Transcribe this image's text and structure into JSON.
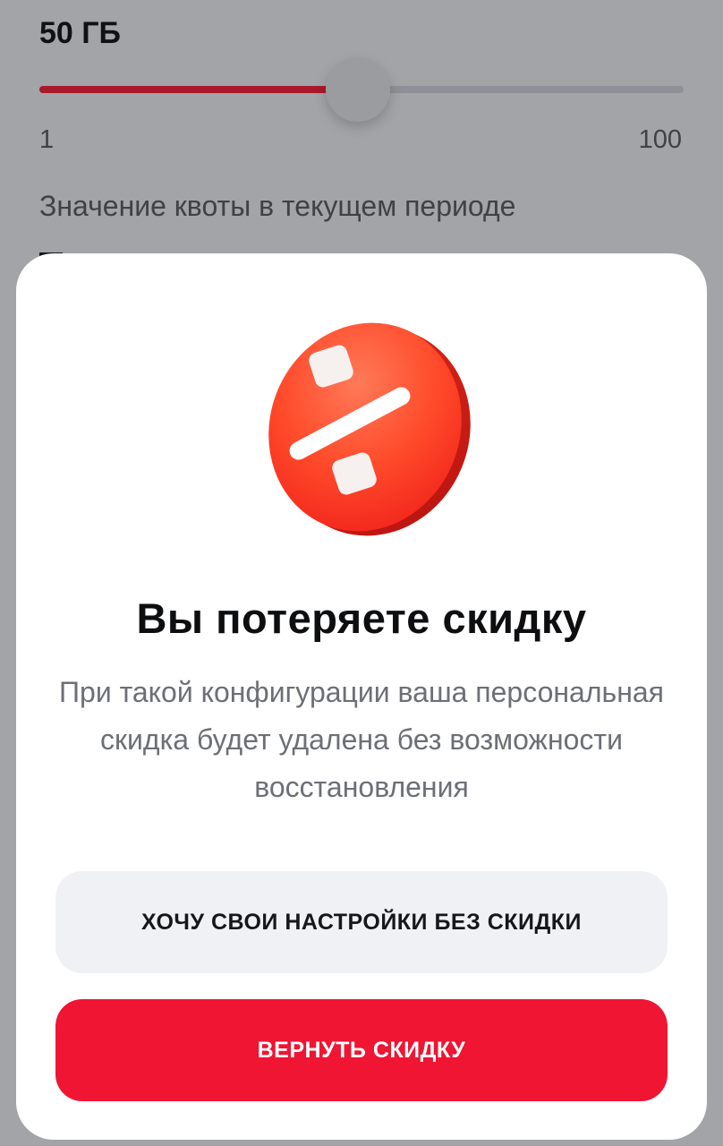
{
  "quota": {
    "value_label": "50 ГБ",
    "slider": {
      "min": 1,
      "max": 100,
      "value": 50,
      "min_label": "1",
      "max_label": "100"
    },
    "section_label": "Значение квоты в текущем периоде"
  },
  "modal": {
    "icon": "percent-discount-icon",
    "title": "Вы потеряете скидку",
    "description": "При такой конфигурации ваша персональная скидка будет удалена без возможности восстановления",
    "secondary_button": "ХОЧУ СВОИ НАСТРОЙКИ БЕЗ СКИДКИ",
    "primary_button": "ВЕРНУТЬ СКИДКУ"
  },
  "colors": {
    "accent": "#ef1533",
    "slider_fill": "#a8192b",
    "overlay_background": "#a3a4a7",
    "secondary_button": "#f0f1f4"
  }
}
